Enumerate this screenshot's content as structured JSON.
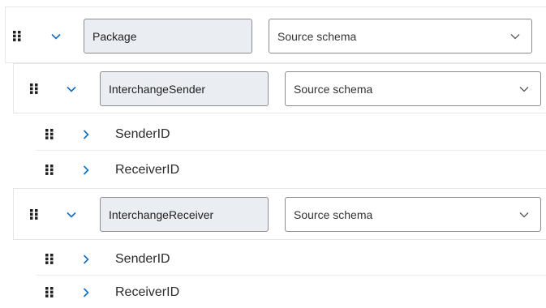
{
  "root": {
    "name_value": "Package",
    "schema_value": "Source schema",
    "expanded": true
  },
  "groups": [
    {
      "name_value": "InterchangeSender",
      "schema_value": "Source schema",
      "expanded": true,
      "children": [
        {
          "label": "SenderID",
          "expanded": false
        },
        {
          "label": "ReceiverID",
          "expanded": false
        }
      ]
    },
    {
      "name_value": "InterchangeReceiver",
      "schema_value": "Source schema",
      "expanded": true,
      "children": [
        {
          "label": "SenderID",
          "expanded": false
        },
        {
          "label": "ReceiverID",
          "expanded": false
        }
      ]
    }
  ],
  "colors": {
    "accent": "#0f6cbd",
    "grip": "#1f1f1f",
    "field_bg": "#eaedf2",
    "border": "#8c8c8c"
  },
  "icons": {
    "drag": "drag-handle-icon",
    "collapse": "chevron-down-icon",
    "expand": "chevron-right-icon",
    "dropdown": "dropdown-caret-icon"
  }
}
